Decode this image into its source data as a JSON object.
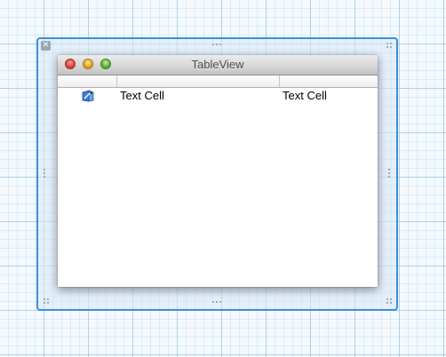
{
  "window": {
    "title": "TableView"
  },
  "table": {
    "rows": [
      {
        "icon": "app-icon",
        "cells": [
          "Text Cell",
          "Text Cell"
        ]
      }
    ]
  },
  "selection_frame": {
    "close_glyph": "✕",
    "color": "#3a8fd9"
  }
}
